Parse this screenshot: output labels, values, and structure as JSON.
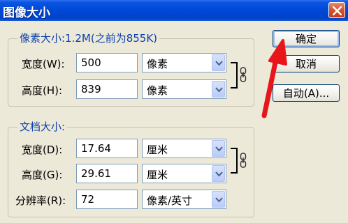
{
  "window": {
    "title": "图像大小"
  },
  "pixel_dimensions": {
    "group_label": "像素大小:1.2M(之前为855K)",
    "width": {
      "label": "宽度(W):",
      "value": "500",
      "unit": "像素"
    },
    "height": {
      "label": "高度(H):",
      "value": "839",
      "unit": "像素"
    }
  },
  "document_size": {
    "group_label": "文档大小:",
    "width": {
      "label": "宽度(D):",
      "value": "17.64",
      "unit": "厘米"
    },
    "height": {
      "label": "高度(G):",
      "value": "29.61",
      "unit": "厘米"
    },
    "resolution": {
      "label": "分辨率(R):",
      "value": "72",
      "unit": "像素/英寸"
    }
  },
  "buttons": {
    "ok": "确定",
    "cancel": "取消",
    "auto": "自动(A)..."
  },
  "colors": {
    "titlebar": "#0048d8",
    "group_title": "#0a3fae",
    "annotation_arrow": "#e8151b",
    "close_button": "#d8552f"
  },
  "icons": {
    "close": "close-icon",
    "dropdown": "chevron-down-icon",
    "link": "chain-link-icon",
    "annotation": "red-arrow-annotation"
  }
}
